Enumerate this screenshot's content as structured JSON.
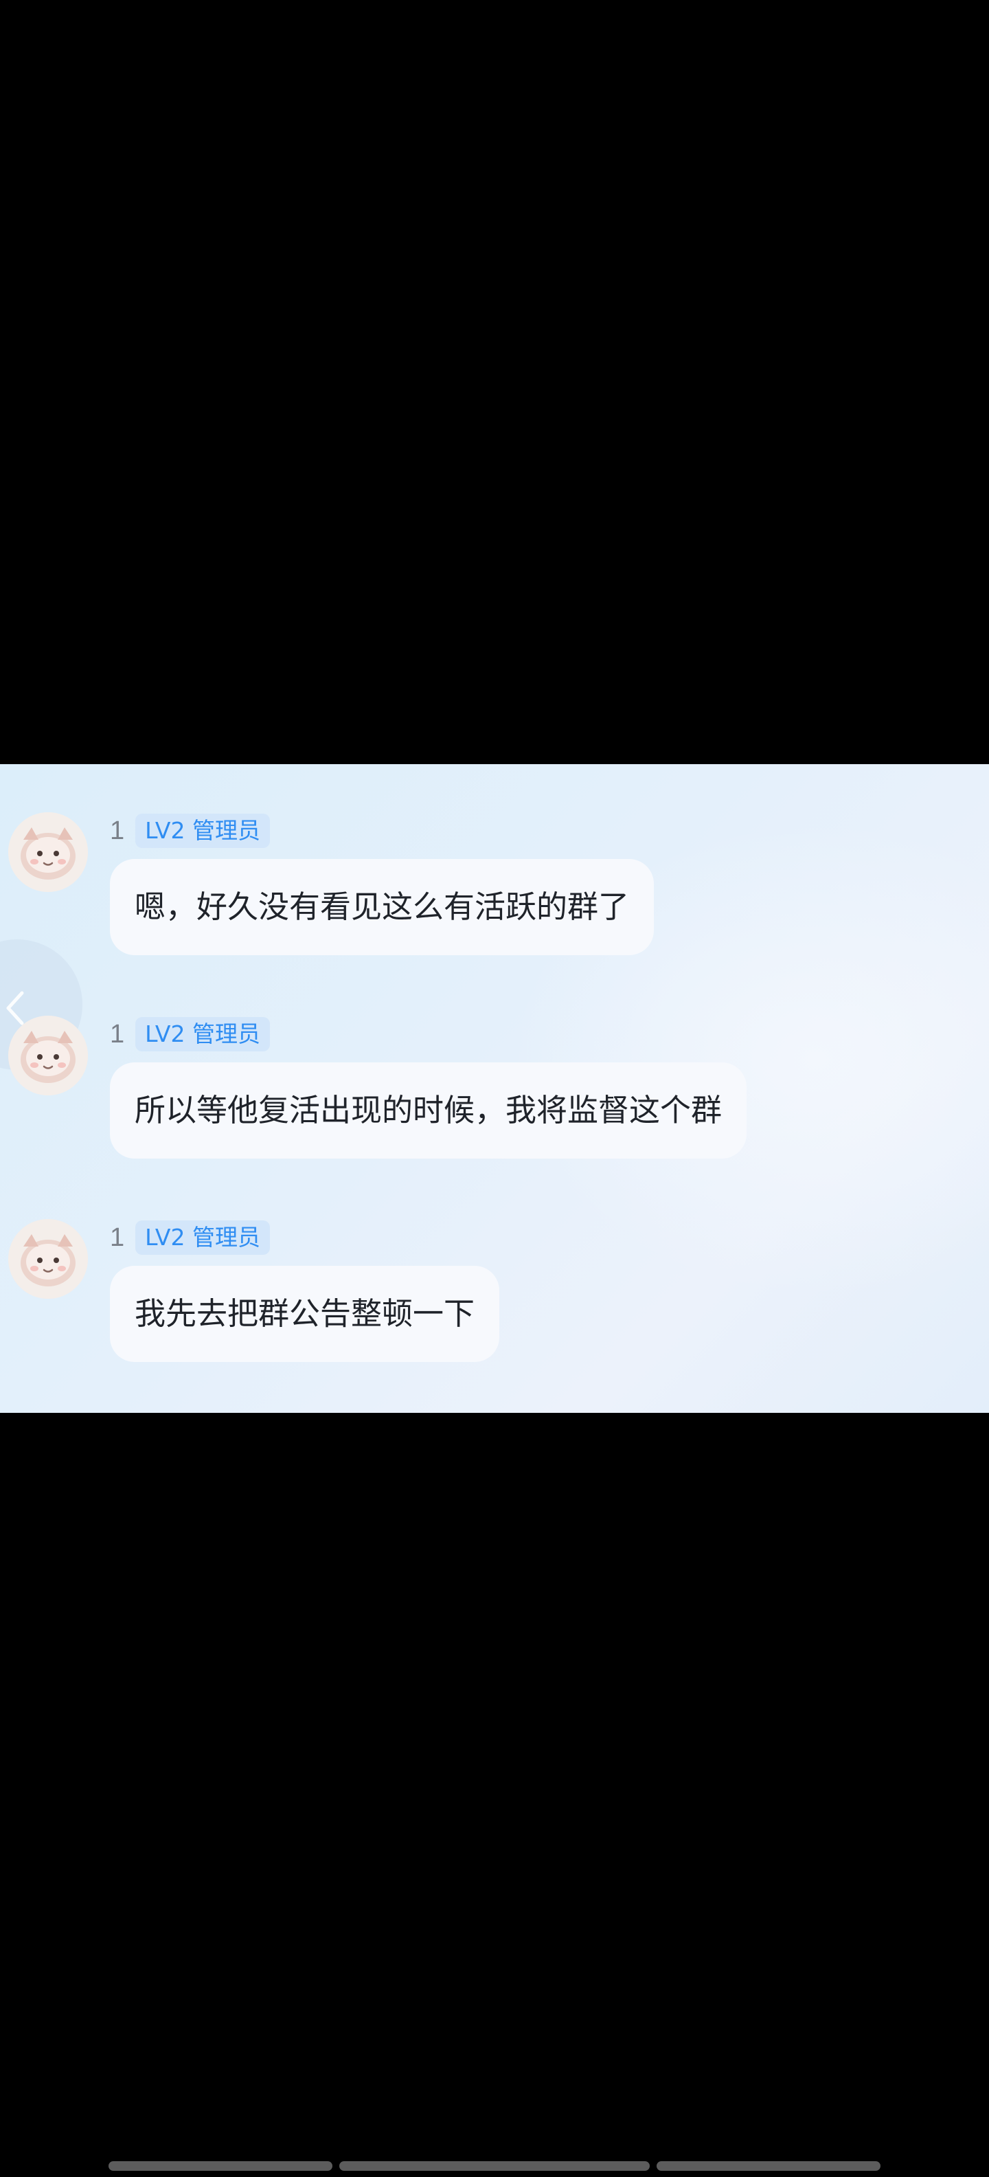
{
  "chat": {
    "messages": [
      {
        "sender_name": "1",
        "badge": "LV2 管理员",
        "text": "嗯，好久没有看见这么有活跃的群了"
      },
      {
        "sender_name": "1",
        "badge": "LV2 管理员",
        "text": "所以等他复活出现的时候，我将监督这个群"
      },
      {
        "sender_name": "1",
        "badge": "LV2 管理员",
        "text": "我先去把群公告整顿一下"
      }
    ]
  },
  "icons": {
    "avatar": "avatar-cat-icon",
    "back": "chevron-left-icon"
  },
  "colors": {
    "page_background": "#000000",
    "chat_background": "#e1eefa",
    "bubble": "#f7f9fd",
    "badge_background": "#d3e6fa",
    "badge_text": "#2f8df2",
    "sender_name": "#7a8089",
    "message_text": "#1f232a"
  }
}
